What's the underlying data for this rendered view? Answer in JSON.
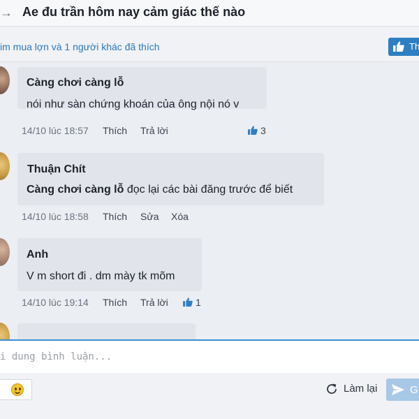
{
  "header": {
    "title": "Ae đu trần hôm nay cảm giác thế nào"
  },
  "likes": {
    "summary": "im mua lợn và 1 người khác đã thích",
    "button_label": "Th"
  },
  "comments": [
    {
      "author": "Càng chơi càng lỗ",
      "text": "nói như sàn chứng khoán của ông nội nó v",
      "time": "14/10 lúc 18:57",
      "actions": [
        "Thích",
        "Trả lời"
      ],
      "likes": "3"
    },
    {
      "author": "Thuận Chít",
      "mention": "Càng chơi càng lỗ",
      "text": " đọc lại các bài đăng trước để biết",
      "time": "14/10 lúc 18:58",
      "actions": [
        "Thích",
        "Sửa",
        "Xóa"
      ]
    },
    {
      "author": "Anh",
      "text": "V m short đi . dm mày tk mõm",
      "time": "14/10 lúc 19:14",
      "actions": [
        "Thích",
        "Trả lời"
      ],
      "likes": "1"
    }
  ],
  "composer": {
    "placeholder": "i dung bình luận...",
    "reset_label": "Làm lại",
    "send_label": "G"
  },
  "icons": [
    "back-arrow-icon",
    "thumbs-up-icon",
    "smiley-icon",
    "refresh-icon",
    "send-icon"
  ],
  "colors": {
    "link": "#2c78b8",
    "like_button": "#2d7fc1",
    "send_button": "#a7c8e6",
    "composer_border": "#3d8fd6"
  }
}
